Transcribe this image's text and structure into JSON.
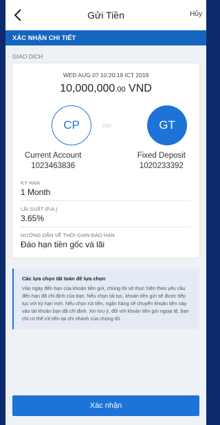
{
  "header": {
    "title": "Gửi Tiền",
    "cancel_label": "Hủy"
  },
  "banner": {
    "title": "XÁC NHẬN CHI TIẾT"
  },
  "section": {
    "label": "GIAO DỊCH"
  },
  "transaction": {
    "datetime": "WED AUG 07 10:20:19 ICT 2019",
    "amount_main": "10,000,000",
    "amount_decimal": ".00",
    "currency": "VND"
  },
  "from_account": {
    "initials": "CP",
    "name": "Current Account",
    "number": "1023463836"
  },
  "to_account": {
    "initials": "GT",
    "name": "Fixed Deposit",
    "number": "1020233392"
  },
  "arrows_glyph": "››››",
  "fields": [
    {
      "label": "KỲ HẠN",
      "value": "1 Month"
    },
    {
      "label": "LÃI SUẤT (P.A.)",
      "value": "3.65%"
    },
    {
      "label": "HƯỚNG DẪN VỀ THỜI GIAN ĐÁO HẠN",
      "value": "Đáo hạn tiền gốc và lãi"
    }
  ],
  "note": {
    "title": "Các lựa chọn tất toán để lựa chọn",
    "body": "Vào ngày đến hạn của khoản tiền gửi, chúng tôi sẽ thực hiện theo yêu cầu đến hạn đã chỉ định của bạn. Nếu chọn tái tục, khoản tiền gửi sẽ được tiếp tục với kỳ hạn mới. Nếu chọn rút tiền, ngân hàng sẽ chuyển khoản tiền này vào tài khoản bạn đã chỉ định. Xin lưu ý, đối với khoản tiền gửi ngoại tệ, bạn chỉ có thể rút tiền tại chi nhánh của chúng tôi."
  },
  "confirm_label": "Xác nhận",
  "colors": {
    "accent": "#1e73d8",
    "banner": "#1565c0",
    "frame": "#0d2a6e",
    "background": "#eef1f6"
  }
}
